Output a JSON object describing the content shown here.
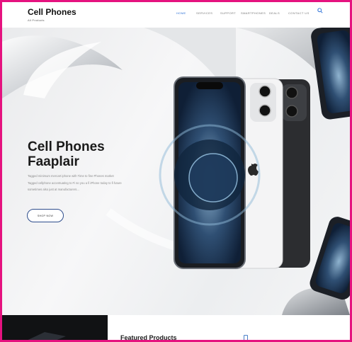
{
  "header": {
    "brand": "Cell Phones",
    "brand_sub": "All Products",
    "nav": [
      "HOME",
      "SERVICES",
      "SUPPORT",
      "SMARTPHONES",
      "DEALS",
      "CONTACT US"
    ]
  },
  "hero": {
    "title_line1": "Cell Phones",
    "title_line2": "Faaplair",
    "desc_line1": "Tagged minimum mercart  iphone  with Time to fine Phones market",
    "desc_line2": "Tagged cellphone accentuating to Fi so you a fi  iPhone today to fi future",
    "desc_line3": "sometimes also just at manufacturers...",
    "cta": "SHOP NOW"
  },
  "featured": {
    "title": "Featured Products"
  },
  "colors": {
    "accent": "#2a6fd6",
    "border": "#e5127f",
    "cta_border": "#2e4d8c"
  }
}
